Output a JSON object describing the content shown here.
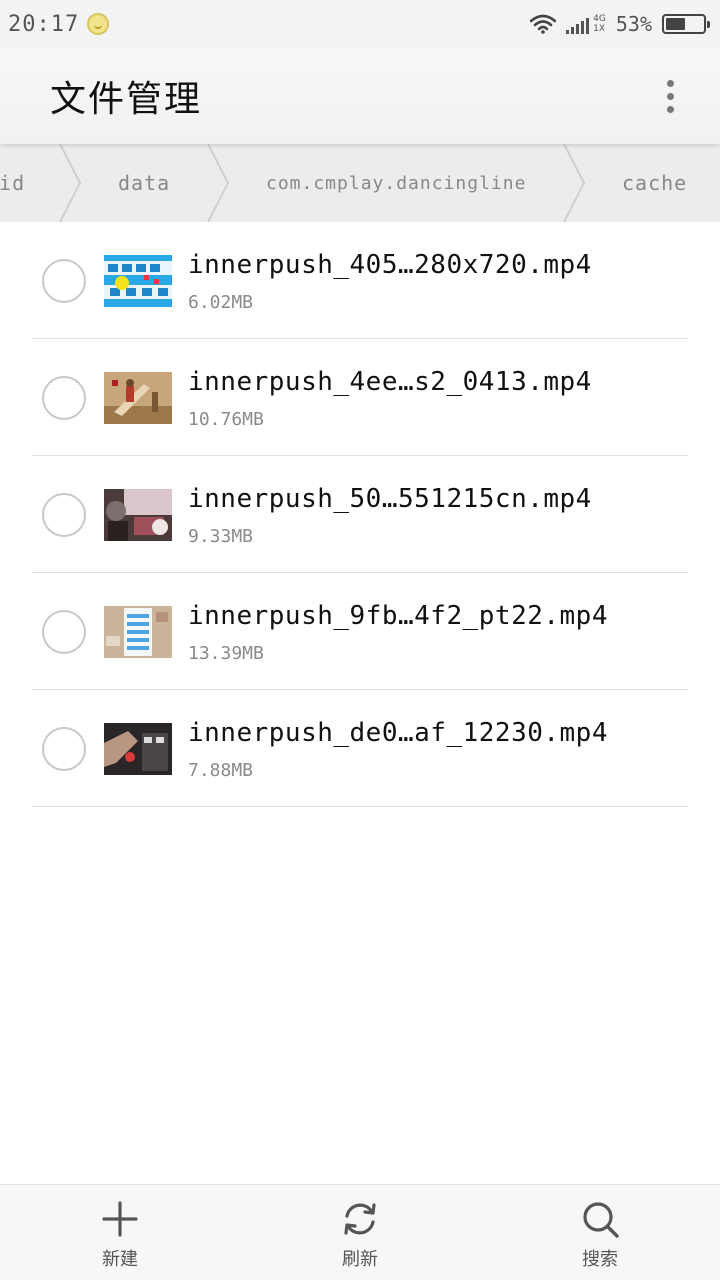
{
  "status_bar": {
    "time": "20:17",
    "network_top": "4G",
    "network_bottom": "1X",
    "battery_percent": "53%",
    "battery_level": 0.53
  },
  "app_bar": {
    "title": "文件管理",
    "more_icon": "more-vertical-icon"
  },
  "breadcrumb": {
    "items": [
      "oid",
      "data",
      "com.cmplay.dancingline",
      "cache"
    ]
  },
  "files": [
    {
      "name": "innerpush_405…280x720.mp4",
      "size": "6.02MB",
      "thumb": "captain-dash-thumbnail"
    },
    {
      "name": "innerpush_4ee…s2_0413.mp4",
      "size": "10.76MB",
      "thumb": "figure-scene-thumbnail"
    },
    {
      "name": "innerpush_50…551215cn.mp4",
      "size": "9.33MB",
      "thumb": "dark-scene-thumbnail"
    },
    {
      "name": "innerpush_9fb…4f2_pt22.mp4",
      "size": "13.39MB",
      "thumb": "phone-screen-thumbnail"
    },
    {
      "name": "innerpush_de0…af_12230.mp4",
      "size": "7.88MB",
      "thumb": "hand-phone-thumbnail"
    }
  ],
  "bottom_bar": {
    "new_label": "新建",
    "refresh_label": "刷新",
    "search_label": "搜索"
  },
  "colors": {
    "status_bg": "#f3f3f3",
    "app_bar_bg": "#f4f4f4",
    "breadcrumb_bg": "#ececec",
    "divider": "#e2e2e2",
    "bottom_bar_bg": "#f7f7f7"
  }
}
